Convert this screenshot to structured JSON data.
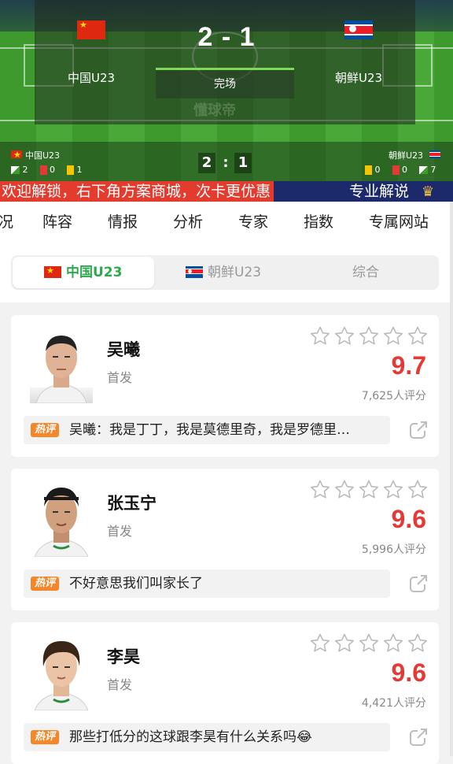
{
  "scoreboard": {
    "home_team": "中国U23",
    "away_team": "朝鲜U23",
    "score": "2 - 1",
    "status": "完场",
    "watermark": "懂球帝",
    "live_bar": {
      "home_team": "中国U23",
      "away_team": "朝鲜U23",
      "home_score": "2",
      "separator": ":",
      "away_score": "1",
      "home_corners": "2",
      "home_red": "0",
      "home_yellow": "1",
      "away_yellow": "0",
      "away_red": "0",
      "away_corners": "7"
    }
  },
  "ticker": {
    "message": "欢迎解锁，右下角方案商城，次卡更优惠",
    "pro_label": "专业解说",
    "colors": {
      "message_bg": "#e33b2e",
      "bar_bg": "#1c2a6b"
    }
  },
  "nav_tabs": [
    "况",
    "阵容",
    "情报",
    "分析",
    "专家",
    "指数",
    "专属网站"
  ],
  "segment": {
    "items": [
      "中国U23",
      "朝鲜U23",
      "综合"
    ],
    "active_index": 0,
    "active_color": "#2fa94f"
  },
  "players": [
    {
      "name": "吴曦",
      "role": "首发",
      "rating": "9.7",
      "count": "7,625人评分",
      "hot_label": "热评",
      "comment": "吴曦：我是丁丁，我是莫德里奇，我是罗德里…"
    },
    {
      "name": "张玉宁",
      "role": "首发",
      "rating": "9.6",
      "count": "5,996人评分",
      "hot_label": "热评",
      "comment": "不好意思我们叫家长了"
    },
    {
      "name": "李昊",
      "role": "首发",
      "rating": "9.6",
      "count": "4,421人评分",
      "hot_label": "热评",
      "comment": "那些打低分的这球跟李昊有什么关系吗😂"
    }
  ],
  "colors": {
    "rating": "#e53935",
    "hot_badge": "#f5862a",
    "star_outline": "#bbbbbb"
  }
}
